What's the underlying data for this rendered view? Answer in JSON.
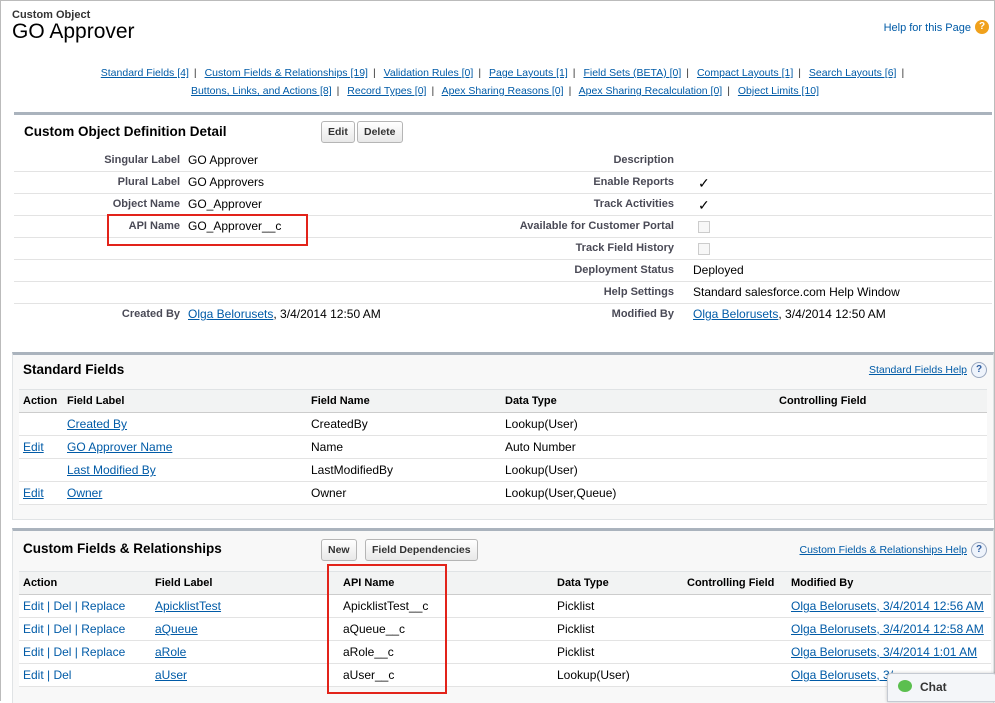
{
  "header": {
    "object_type": "Custom Object",
    "title": "GO Approver",
    "help_link": "Help for this Page",
    "help_icon": "?"
  },
  "jump_links": {
    "row1": [
      "Standard Fields [4]",
      "Custom Fields & Relationships [19]",
      "Validation Rules [0]",
      "Page Layouts [1]",
      "Field Sets (BETA) [0]",
      "Compact Layouts [1]",
      "Search Layouts [6]"
    ],
    "row2": [
      "Buttons, Links, and Actions [8]",
      "Record Types [0]",
      "Apex Sharing Reasons [0]",
      "Apex Sharing Recalculation [0]",
      "Object Limits [10]"
    ],
    "separator": "|"
  },
  "detail": {
    "title": "Custom Object Definition Detail",
    "edit_label": "Edit",
    "delete_label": "Delete",
    "left": [
      {
        "label": "Singular Label",
        "value": "GO Approver"
      },
      {
        "label": "Plural Label",
        "value": "GO Approvers"
      },
      {
        "label": "Object Name",
        "value": "GO_Approver"
      },
      {
        "label": "API Name",
        "value": "GO_Approver__c"
      }
    ],
    "right": [
      {
        "label": "Description",
        "value": ""
      },
      {
        "label": "Enable Reports",
        "value": "✓"
      },
      {
        "label": "Track Activities",
        "value": "✓"
      },
      {
        "label": "Available for Customer Portal",
        "value": ""
      },
      {
        "label": "Track Field History",
        "value": ""
      },
      {
        "label": "Deployment Status",
        "value": "Deployed"
      },
      {
        "label": "Help Settings",
        "value": "Standard salesforce.com Help Window"
      }
    ],
    "created_by_label": "Created By",
    "created_by_user": "Olga Belorusets",
    "created_by_date": ", 3/4/2014 12:50 AM",
    "modified_by_label": "Modified By",
    "modified_by_user": "Olga Belorusets",
    "modified_by_date": ", 3/4/2014 12:50 AM"
  },
  "standard_fields": {
    "title": "Standard Fields",
    "help": "Standard Fields Help",
    "columns": [
      "Action",
      "Field Label",
      "Field Name",
      "Data Type",
      "Controlling Field"
    ],
    "rows": [
      {
        "action": "",
        "label": "Created By",
        "name": "CreatedBy",
        "type": "Lookup(User)",
        "controlling": ""
      },
      {
        "action": "Edit",
        "label": "GO Approver Name",
        "name": "Name",
        "type": "Auto Number",
        "controlling": ""
      },
      {
        "action": "",
        "label": "Last Modified By",
        "name": "LastModifiedBy",
        "type": "Lookup(User)",
        "controlling": ""
      },
      {
        "action": "Edit",
        "label": "Owner",
        "name": "Owner",
        "type": "Lookup(User,Queue)",
        "controlling": ""
      }
    ]
  },
  "custom_fields": {
    "title": "Custom Fields & Relationships",
    "new_label": "New",
    "deps_label": "Field Dependencies",
    "help": "Custom Fields & Relationships Help",
    "columns": [
      "Action",
      "Field Label",
      "API Name",
      "Data Type",
      "Controlling Field",
      "Modified By"
    ],
    "rows": [
      {
        "action": "Edit | Del | Replace",
        "label": "ApicklistTest",
        "api": "ApicklistTest__c",
        "type": "Picklist",
        "controlling": "",
        "modified": "Olga Belorusets, 3/4/2014 12:56 AM"
      },
      {
        "action": "Edit | Del | Replace",
        "label": "aQueue",
        "api": "aQueue__c",
        "type": "Picklist",
        "controlling": "",
        "modified": "Olga Belorusets, 3/4/2014 12:58 AM"
      },
      {
        "action": "Edit | Del | Replace",
        "label": "aRole",
        "api": "aRole__c",
        "type": "Picklist",
        "controlling": "",
        "modified": "Olga Belorusets, 3/4/2014 1:01 AM"
      },
      {
        "action": "Edit | Del",
        "label": "aUser",
        "api": "aUser__c",
        "type": "Lookup(User)",
        "controlling": "",
        "modified": "Olga Belorusets, 3/"
      }
    ]
  },
  "chat": {
    "label": "Chat"
  }
}
